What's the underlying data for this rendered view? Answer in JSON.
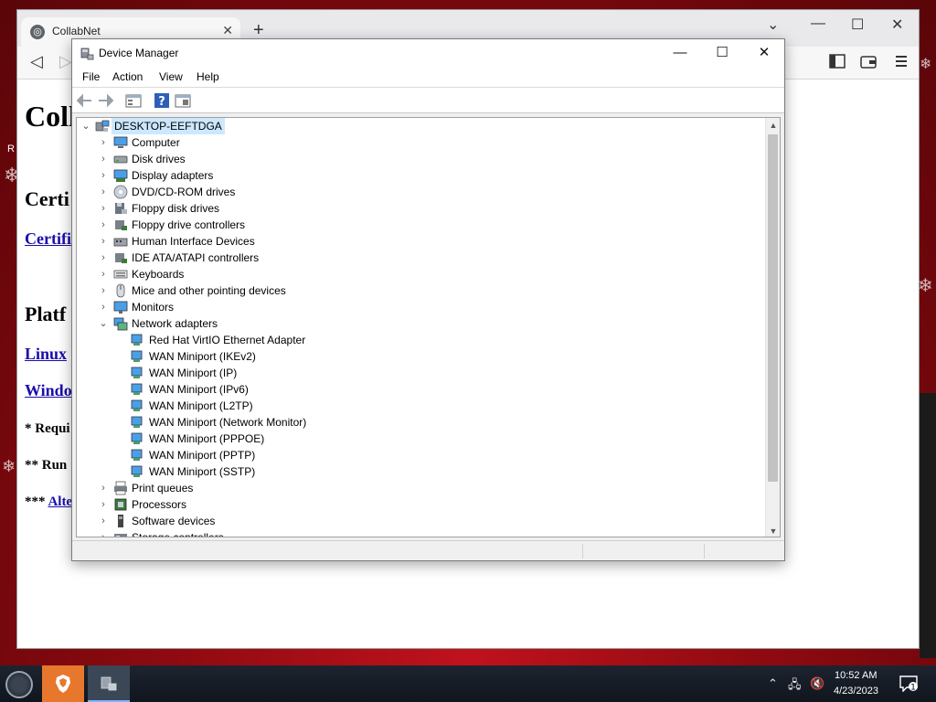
{
  "browser": {
    "tab_title": "CollabNet",
    "page": {
      "heading": "Coll",
      "section_certi": "Certi",
      "link_certi": "Certifi",
      "section_platf": "Platf",
      "link_linux": "Linux",
      "link_windo": "Windo",
      "note_requi": "* Requi",
      "note_run": "** Run",
      "note_alte_prefix": "*** ",
      "note_alte_link": "Alte"
    },
    "side_fragment": "R"
  },
  "device_manager": {
    "title": "Device Manager",
    "menu": [
      "File",
      "Action",
      "View",
      "Help"
    ],
    "root": "DESKTOP-EEFTDGA",
    "categories": [
      {
        "label": "Computer",
        "icon": "computer-icon",
        "expanded": false
      },
      {
        "label": "Disk drives",
        "icon": "disk-drive-icon",
        "expanded": false
      },
      {
        "label": "Display adapters",
        "icon": "display-adapter-icon",
        "expanded": false
      },
      {
        "label": "DVD/CD-ROM drives",
        "icon": "dvd-icon",
        "expanded": false
      },
      {
        "label": "Floppy disk drives",
        "icon": "floppy-icon",
        "expanded": false
      },
      {
        "label": "Floppy drive controllers",
        "icon": "controller-icon",
        "expanded": false
      },
      {
        "label": "Human Interface Devices",
        "icon": "hid-icon",
        "expanded": false
      },
      {
        "label": "IDE ATA/ATAPI controllers",
        "icon": "controller-icon",
        "expanded": false
      },
      {
        "label": "Keyboards",
        "icon": "keyboard-icon",
        "expanded": false
      },
      {
        "label": "Mice and other pointing devices",
        "icon": "mouse-icon",
        "expanded": false
      },
      {
        "label": "Monitors",
        "icon": "monitor-icon",
        "expanded": false
      },
      {
        "label": "Network adapters",
        "icon": "network-icon",
        "expanded": true
      }
    ],
    "network_children": [
      "Red Hat VirtIO Ethernet Adapter",
      "WAN Miniport (IKEv2)",
      "WAN Miniport (IP)",
      "WAN Miniport (IPv6)",
      "WAN Miniport (L2TP)",
      "WAN Miniport (Network Monitor)",
      "WAN Miniport (PPPOE)",
      "WAN Miniport (PPTP)",
      "WAN Miniport (SSTP)"
    ],
    "after_categories": [
      {
        "label": "Print queues",
        "icon": "printer-icon"
      },
      {
        "label": "Processors",
        "icon": "processor-icon"
      },
      {
        "label": "Software devices",
        "icon": "software-device-icon"
      },
      {
        "label": "Storage controllers",
        "icon": "storage-controller-icon"
      }
    ]
  },
  "taskbar": {
    "time": "10:52 AM",
    "date": "4/23/2023",
    "notification_count": "1"
  },
  "colors": {
    "selection": "#cce8ff",
    "link": "#1a0dab",
    "brave": "#e8772e"
  }
}
